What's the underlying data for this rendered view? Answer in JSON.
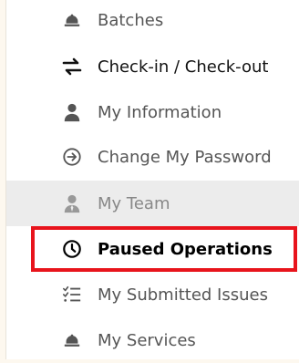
{
  "menu": {
    "items": [
      {
        "label": "Batches",
        "icon": "bell-icon"
      },
      {
        "label": "Check-in / Check-out",
        "icon": "swap-arrows-icon"
      },
      {
        "label": "My Information",
        "icon": "user-icon"
      },
      {
        "label": "Change My Password",
        "icon": "circle-arrow-right-icon"
      },
      {
        "label": "My Team",
        "icon": "user-tie-icon",
        "state": "active"
      },
      {
        "label": "Paused Operations",
        "icon": "clock-icon",
        "state": "highlighted"
      },
      {
        "label": "My Submitted Issues",
        "icon": "list-check-icon"
      },
      {
        "label": "My Services",
        "icon": "bell-icon"
      }
    ]
  },
  "colors": {
    "highlight_border": "#e8141c",
    "active_background": "#ececec",
    "page_background": "#fdf8ef"
  }
}
